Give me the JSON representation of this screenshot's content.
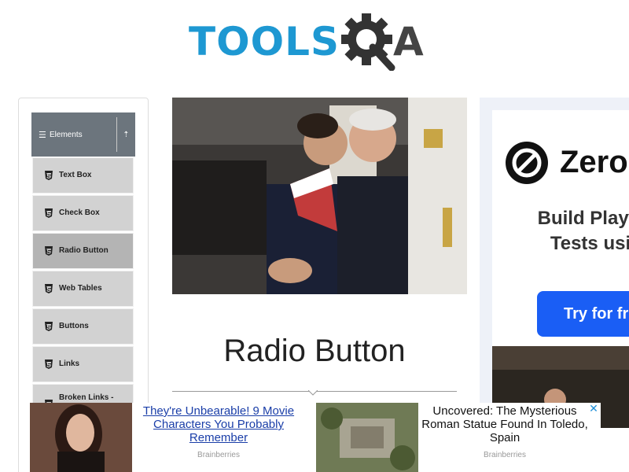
{
  "header": {
    "logo_text": "TOOLS",
    "logo_suffix": "A"
  },
  "sidebar": {
    "group_label": "Elements",
    "items": [
      {
        "label": "Text Box"
      },
      {
        "label": "Check Box"
      },
      {
        "label": "Radio Button",
        "active": true
      },
      {
        "label": "Web Tables"
      },
      {
        "label": "Buttons"
      },
      {
        "label": "Links"
      },
      {
        "label": "Broken Links -"
      }
    ]
  },
  "main": {
    "page_title": "Radio Button"
  },
  "side_ad": {
    "brand": "Zero",
    "line1": "Build Playw",
    "line2": "Tests usi",
    "button": "Try for fre"
  },
  "bottom_ad": {
    "items": [
      {
        "headline": "They're Unbearable! 9 Movie Characters You Probably Remember",
        "source": "Brainberries"
      },
      {
        "headline": "Uncovered: The Mysterious Roman Statue Found In Toledo, Spain",
        "source": "Brainberries"
      }
    ],
    "close_label": "✕"
  },
  "colors": {
    "brand_blue": "#1e98d2",
    "sidebar_header": "#6c757d",
    "menu_item": "#d2d2d2",
    "menu_active": "#b4b4b4",
    "ad_button": "#1a5ef5",
    "link": "#1a3ea8"
  }
}
